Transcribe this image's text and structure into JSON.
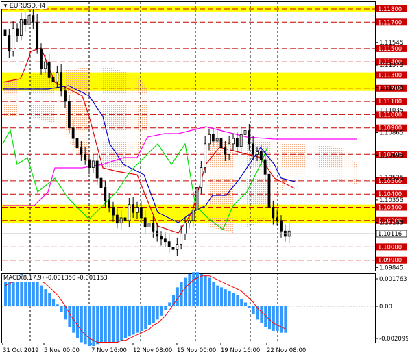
{
  "symbol": {
    "label": "EURUSD,H4",
    "icon": "triangle-down-icon"
  },
  "colors": {
    "bull_candle": "#000000",
    "bear_candle": "#000000",
    "level_line": "#cc0000",
    "highlight_zone": "#ffff00",
    "tenkan": "#e00000",
    "kijun": "#0000cc",
    "chikou": "#00dd00",
    "senkou_b": "#ff00ff",
    "cloud": "#f4a77a",
    "macd_hist": "#3399ff",
    "macd_signal": "#ff0000"
  },
  "price_axis": {
    "levels": [
      "1.11800",
      "1.11700",
      "1.11500",
      "1.11400",
      "1.11300",
      "1.11200",
      "1.11100",
      "1.11000",
      "1.10900",
      "1.10700",
      "1.10500",
      "1.10400",
      "1.10300",
      "1.10200",
      "1.10000",
      "1.09900"
    ],
    "ticks": [
      "1.11545",
      "1.11375",
      "1.11205",
      "1.11035",
      "1.10865",
      "1.10695",
      "1.10525",
      "1.10355",
      "1.10185",
      "1.09845"
    ],
    "current_price": "1.10116",
    "highlighted_levels": [
      "1.11800",
      "1.11300",
      "1.11200",
      "1.10500",
      "1.10300",
      "1.10200",
      "1.10000",
      "1.09900"
    ]
  },
  "highlight_zones": [
    {
      "from": 1.1178,
      "to": 1.1182
    },
    {
      "from": 1.1118,
      "to": 1.1132
    },
    {
      "from": 1.1018,
      "to": 1.1032
    }
  ],
  "macd": {
    "label": "MACD(8,17,9) -0.001350 -0.001153",
    "ticks": [
      "0.001763",
      "0.00",
      "-0.002099"
    ]
  },
  "time_axis": [
    "31 Oct 2019",
    "5 Nov 00:00",
    "7 Nov 16:00",
    "12 Nov 08:00",
    "15 Nov 00:00",
    "19 Nov 16:00",
    "22 Nov 08:00"
  ],
  "chart_data": {
    "type": "candlestick",
    "price_range": [
      1.09845,
      1.1183
    ],
    "closes": [
      1.116,
      1.1148,
      1.1165,
      1.116,
      1.1172,
      1.1168,
      1.1175,
      1.117,
      1.115,
      1.1135,
      1.114,
      1.1128,
      1.1125,
      1.1132,
      1.1118,
      1.111,
      1.109,
      1.1082,
      1.1075,
      1.107,
      1.1066,
      1.106,
      1.1065,
      1.1052,
      1.1045,
      1.1035,
      1.103,
      1.1024,
      1.1018,
      1.1022,
      1.102,
      1.1032,
      1.1026,
      1.103,
      1.1022,
      1.1015,
      1.1018,
      1.1012,
      1.1008,
      1.1006,
      1.1004,
      1.1,
      1.0998,
      1.1002,
      1.101,
      1.1018,
      1.102,
      1.1028,
      1.1045,
      1.106,
      1.1078,
      1.1085,
      1.108,
      1.1082,
      1.1075,
      1.107,
      1.1078,
      1.1082,
      1.1076,
      1.1085,
      1.1088,
      1.1078,
      1.107,
      1.1072,
      1.1066,
      1.1055,
      1.103,
      1.1022,
      1.102,
      1.1012,
      1.1008,
      1.1012
    ],
    "macd_hist": [
      0.0014,
      0.0015,
      0.0016,
      0.0016,
      0.0017,
      0.0016,
      0.0016,
      0.0015,
      0.0013,
      0.0011,
      0.0009,
      0.0007,
      0.0004,
      0.0001,
      -0.0003,
      -0.0007,
      -0.0011,
      -0.0014,
      -0.0017,
      -0.0019,
      -0.002,
      -0.0021,
      -0.0021,
      -0.002,
      -0.0019,
      -0.0019,
      -0.0019,
      -0.0019,
      -0.0019,
      -0.0018,
      -0.0017,
      -0.0016,
      -0.0015,
      -0.0014,
      -0.0013,
      -0.0012,
      -0.001,
      -0.0009,
      -0.0007,
      -0.0005,
      -0.0002,
      0.0002,
      0.0006,
      0.001,
      0.0013,
      0.0015,
      0.0017,
      0.0018,
      0.0018,
      0.0017,
      0.0016,
      0.0015,
      0.0013,
      0.0011,
      0.001,
      0.0009,
      0.0008,
      0.0007,
      0.0006,
      0.0004,
      0.0002,
      -0.0001,
      -0.0004,
      -0.0007,
      -0.0009,
      -0.0011,
      -0.0012,
      -0.0013,
      -0.0013,
      -0.0014,
      -0.0014
    ],
    "macd_signal": [
      0.0011,
      0.0012,
      0.0013,
      0.0014,
      0.0015,
      0.0015,
      0.0015,
      0.0015,
      0.0014,
      0.0013,
      0.0012,
      0.001,
      0.0008,
      0.0006,
      0.0003,
      0.0,
      -0.0004,
      -0.0007,
      -0.001,
      -0.0013,
      -0.0015,
      -0.0017,
      -0.0018,
      -0.0019,
      -0.0019,
      -0.0019,
      -0.0019,
      -0.0019,
      -0.0019,
      -0.0018,
      -0.0018,
      -0.0017,
      -0.0016,
      -0.0015,
      -0.0014,
      -0.0013,
      -0.0012,
      -0.001,
      -0.0009,
      -0.0007,
      -0.0005,
      -0.0002,
      0.0001,
      0.0004,
      0.0007,
      0.001,
      0.0012,
      0.0014,
      0.0015,
      0.0016,
      0.0016,
      0.0016,
      0.0015,
      0.0014,
      0.0013,
      0.0012,
      0.0011,
      0.001,
      0.0009,
      0.0008,
      0.0006,
      0.0004,
      0.0002,
      -0.0001,
      -0.0003,
      -0.0005,
      -0.0007,
      -0.0009,
      -0.001,
      -0.0011,
      -0.0012
    ]
  }
}
